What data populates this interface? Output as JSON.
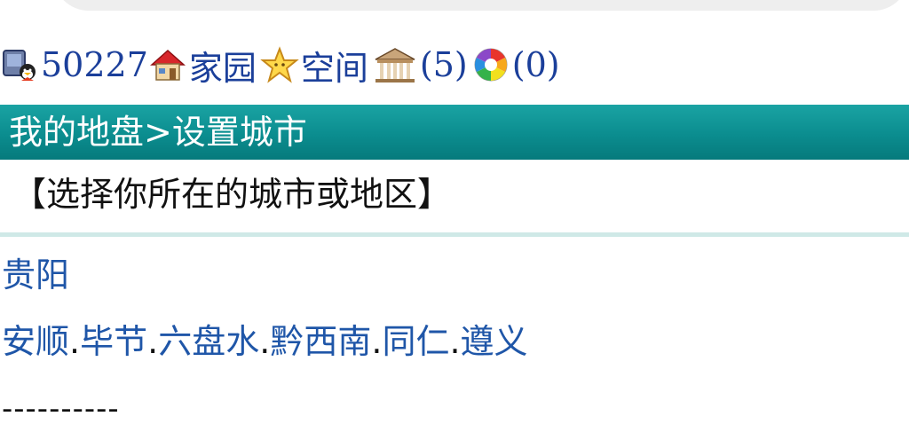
{
  "status": {
    "user_id": "50227",
    "home_label": "家园",
    "space_label": "空间",
    "messages_count": "(5)",
    "photos_count": "(0)"
  },
  "title": "我的地盘>设置城市",
  "prompt": "【选择你所在的城市或地区】",
  "province": "贵阳",
  "cities": [
    {
      "label": "安顺",
      "sep": "."
    },
    {
      "label": "毕节",
      "sep": "."
    },
    {
      "label": "六盘水",
      "sep": "."
    },
    {
      "label": "黔西南",
      "sep": "."
    },
    {
      "label": "同仁",
      "sep": "."
    },
    {
      "label": "遵义",
      "sep": ""
    }
  ],
  "footer_dashes": "----------",
  "icons": {
    "user": "qq-user-icon",
    "home": "house-icon",
    "space": "star-icon",
    "messages": "building-icon",
    "photos": "aperture-icon"
  }
}
